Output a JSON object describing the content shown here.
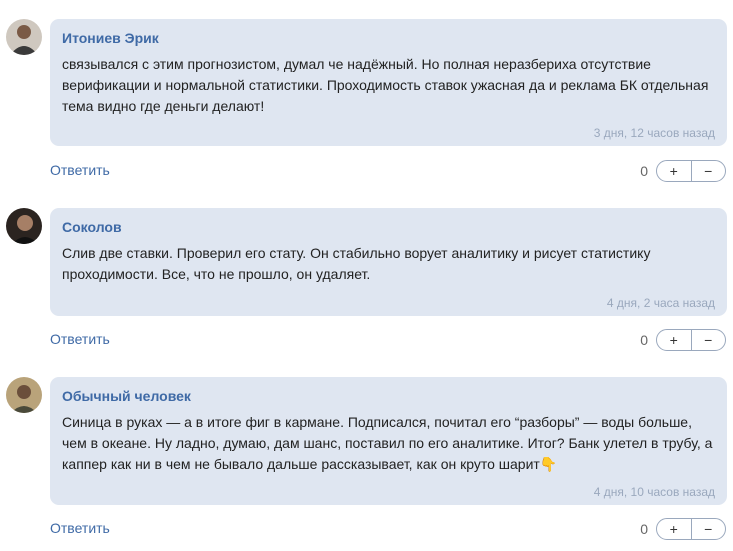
{
  "comments": [
    {
      "author": "Итониев Эрик",
      "text": "связывался с этим прогнозистом, думал че надёжный. Но полная неразбериха отсутствие верификации и нормальной статистики. Проходимость ставок ужасная да и реклама БК отдельная тема видно где деньги делают!",
      "time": "3 дня, 12 часов назад",
      "reply": "Ответить",
      "score": "0",
      "plus": "+",
      "minus": "−"
    },
    {
      "author": "Соколов",
      "text": "Слив две ставки. Проверил его стату. Он стабильно ворует аналитику и рисует статистику проходимости. Все, что не прошло, он удаляет.",
      "time": "4 дня, 2 часа назад",
      "reply": "Ответить",
      "score": "0",
      "plus": "+",
      "minus": "−"
    },
    {
      "author": "Обычный человек",
      "text": "Синица в руках — а в итоге фиг в кармане. Подписался, почитал его “разборы” — воды больше, чем в океане. Ну ладно, думаю, дам шанс, поставил по его аналитике. Итог? Банк улетел в трубу, а каппер как ни в чем не бывало дальше рассказывает, как он круто шарит👇",
      "time": "4 дня, 10 часов назад",
      "reply": "Ответить",
      "score": "0",
      "plus": "+",
      "minus": "−"
    }
  ]
}
